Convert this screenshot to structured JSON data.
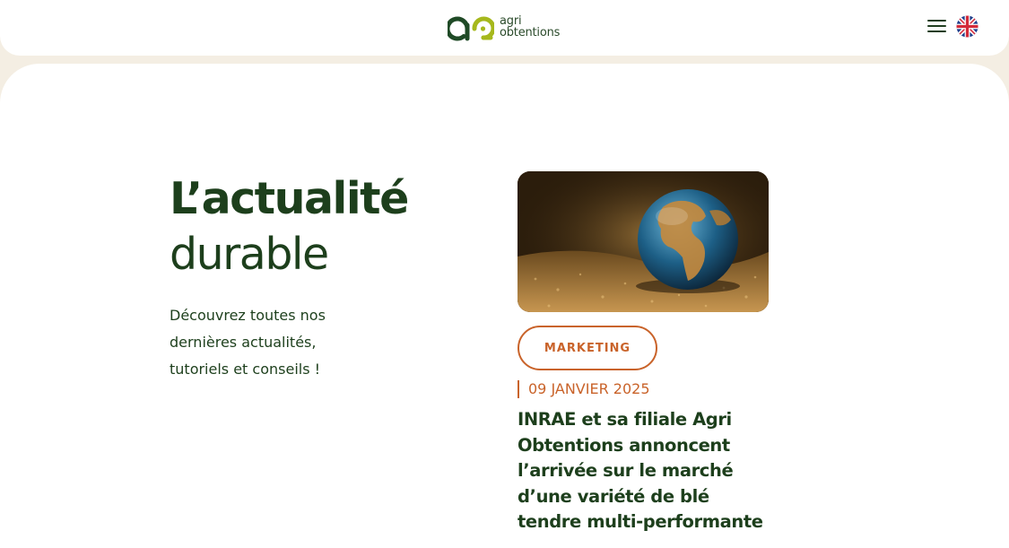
{
  "header": {
    "logo_line1": "agri",
    "logo_line2": "obtentions",
    "menu_icon": "hamburger-menu-icon",
    "language_icon": "uk-flag-icon"
  },
  "hero": {
    "title_bold": "L’actualité",
    "title_light": "durable",
    "intro": "Découvrez toutes nos dernières actualités, tutoriels et conseils !"
  },
  "article": {
    "category": "MARKETING",
    "date": "09 JANVIER 2025",
    "title": "INRAE et sa filiale Agri Obtentions annoncent l’arrivée sur le marché d’une variété de blé tendre multi-performante"
  },
  "colors": {
    "primary_green": "#1d3f1c",
    "accent_orange": "#c9632a",
    "logo_lime": "#a6b81c",
    "background_beige": "#f4eee3"
  }
}
